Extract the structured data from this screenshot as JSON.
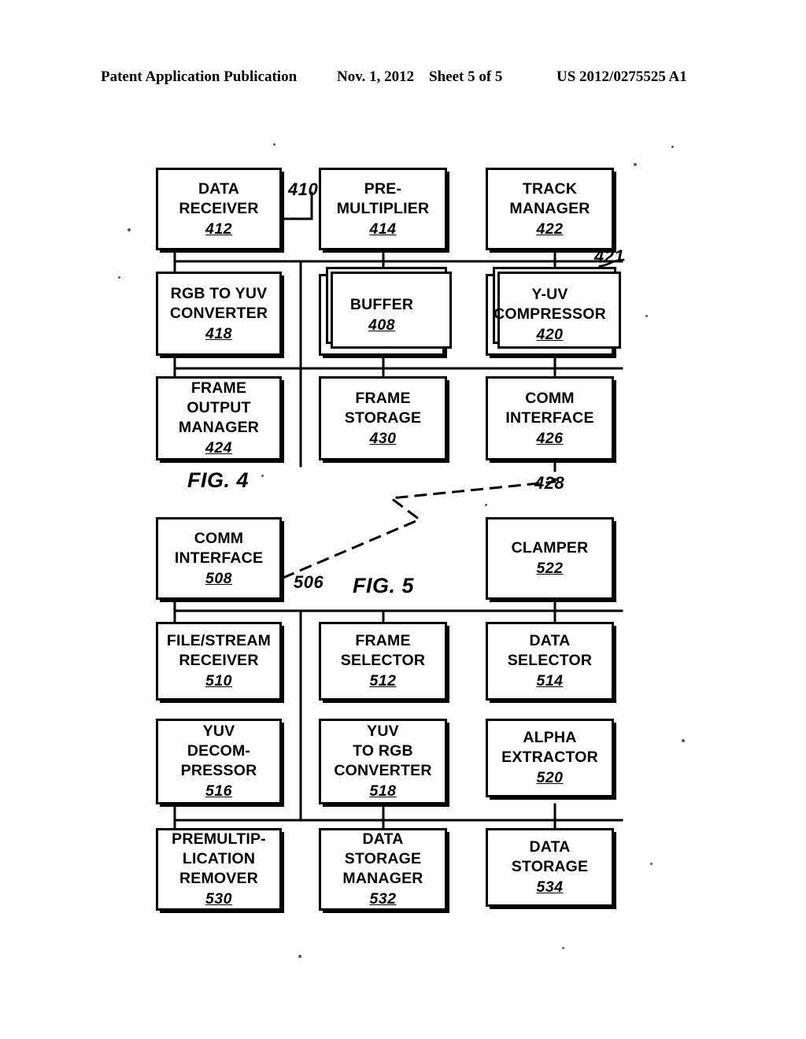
{
  "header": {
    "title": "Patent Application Publication",
    "date": "Nov. 1, 2012",
    "sheet": "Sheet 5 of 5",
    "pub_number": "US 2012/0275525 A1"
  },
  "figures": [
    {
      "caption": "FIG. 4",
      "system_ref": "410",
      "bus_ref": "421",
      "link_ref": "428"
    },
    {
      "caption": "FIG. 5",
      "link_ref": "506"
    }
  ],
  "nodes": {
    "data_receiver": {
      "label": "DATA\nRECEIVER",
      "ref": "412"
    },
    "pre_multiplier": {
      "label": "PRE-\nMULTIPLIER",
      "ref": "414"
    },
    "track_manager": {
      "label": "TRACK\nMANAGER",
      "ref": "422"
    },
    "rgb_to_yuv": {
      "label": "RGB TO YUV\nCONVERTER",
      "ref": "418"
    },
    "buffer": {
      "label": "BUFFER",
      "ref": "408"
    },
    "y_uv_compressor": {
      "label": "Y-UV\nCOMPRESSOR",
      "ref": "420"
    },
    "frame_output_mgr": {
      "label": "FRAME\nOUTPUT\nMANAGER",
      "ref": "424"
    },
    "frame_storage": {
      "label": "FRAME\nSTORAGE",
      "ref": "430"
    },
    "comm_interface_426": {
      "label": "COMM\nINTERFACE",
      "ref": "426"
    },
    "comm_interface_508": {
      "label": "COMM\nINTERFACE",
      "ref": "508"
    },
    "clamper": {
      "label": "CLAMPER",
      "ref": "522"
    },
    "file_stream_rx": {
      "label": "FILE/STREAM\nRECEIVER",
      "ref": "510"
    },
    "frame_selector": {
      "label": "FRAME\nSELECTOR",
      "ref": "512"
    },
    "data_selector": {
      "label": "DATA\nSELECTOR",
      "ref": "514"
    },
    "yuv_decompressor": {
      "label": "YUV\nDECOM-\nPRESSOR",
      "ref": "516"
    },
    "yuv_to_rgb": {
      "label": "YUV\nTO RGB\nCONVERTER",
      "ref": "518"
    },
    "alpha_extractor": {
      "label": "ALPHA\nEXTRACTOR",
      "ref": "520"
    },
    "premult_remover": {
      "label": "PREMULTIP-\nLICATION\nREMOVER",
      "ref": "530"
    },
    "data_storage_mgr": {
      "label": "DATA\nSTORAGE\nMANAGER",
      "ref": "532"
    },
    "data_storage_534": {
      "label": "DATA\nSTORAGE",
      "ref": "534"
    }
  },
  "colors": {
    "ink": "#000000",
    "paper": "#ffffff"
  }
}
